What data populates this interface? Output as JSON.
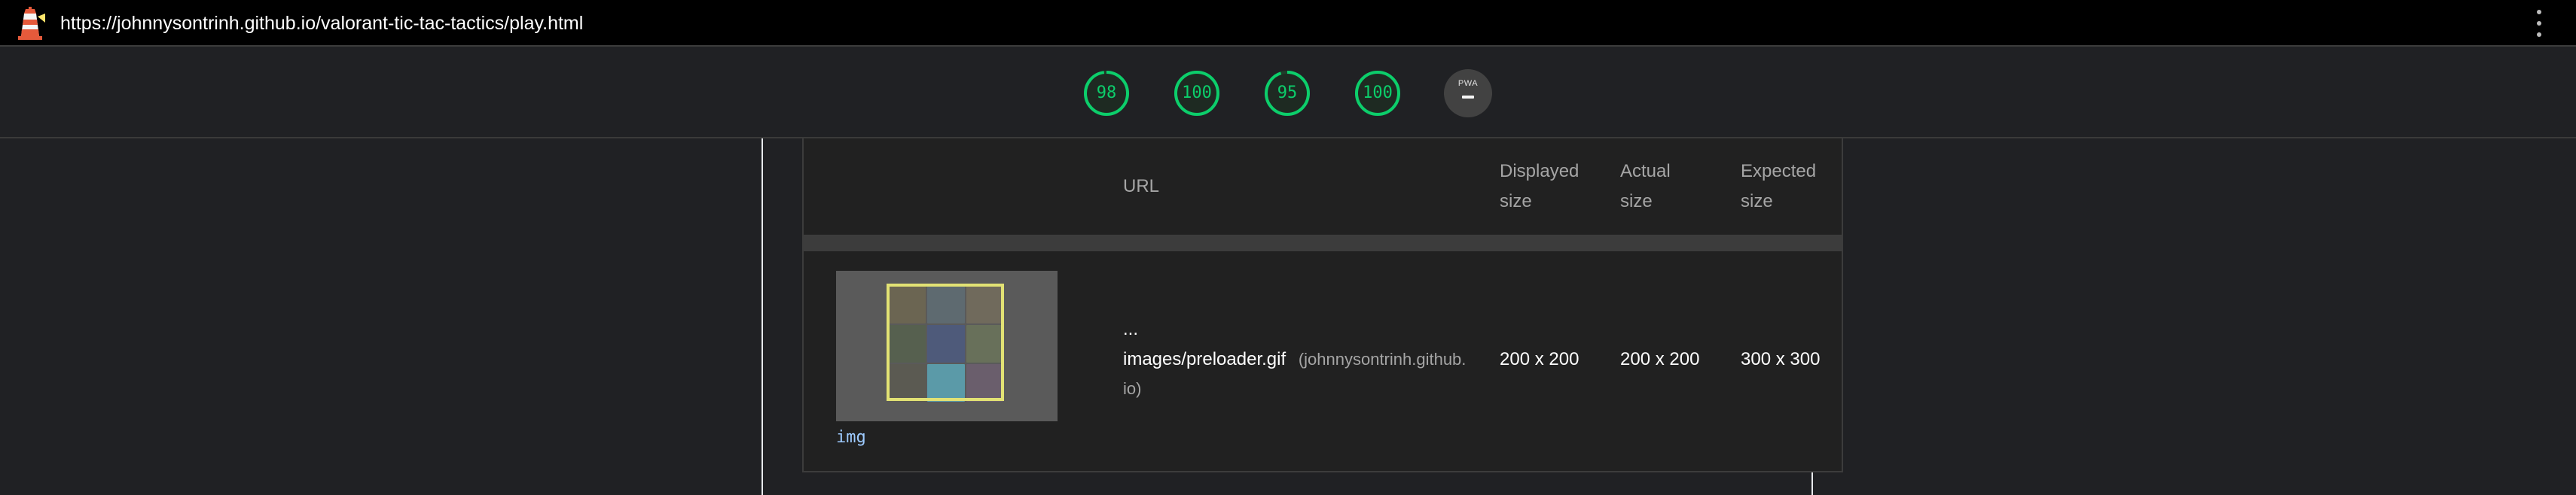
{
  "address_bar": {
    "url": "https://johnnysontrinh.github.io/valorant-tic-tac-tactics/play.html",
    "logo_icon": "lighthouse-icon",
    "menu_icon": "kebab-menu-icon"
  },
  "scores": [
    {
      "value": "98",
      "fraction": 0.98,
      "color": "#0cce6b"
    },
    {
      "value": "100",
      "fraction": 1.0,
      "color": "#0cce6b"
    },
    {
      "value": "95",
      "fraction": 0.95,
      "color": "#0cce6b"
    },
    {
      "value": "100",
      "fraction": 1.0,
      "color": "#0cce6b"
    }
  ],
  "pwa_badge": {
    "label": "PWA",
    "value": "—"
  },
  "table": {
    "headers": {
      "url": "URL",
      "displayed_line1": "Displayed",
      "displayed_line2": "size",
      "actual_line1": "Actual",
      "actual_line2": "size",
      "expected_line1": "Expected",
      "expected_line2": "size"
    },
    "rows": [
      {
        "node_label": "img",
        "url_ellipsis": "...",
        "url_path": "images/preloader.gif",
        "url_origin_part1": "(johnnysontrinh.github.",
        "url_origin_part2": "io)",
        "displayed_size": "200 x 200",
        "actual_size": "200 x 200",
        "expected_size": "300 x 300"
      }
    ]
  },
  "colors": {
    "pass_green": "#0cce6b",
    "highlight_yellow": "#e2e274",
    "node_blue": "#9ecbff"
  }
}
